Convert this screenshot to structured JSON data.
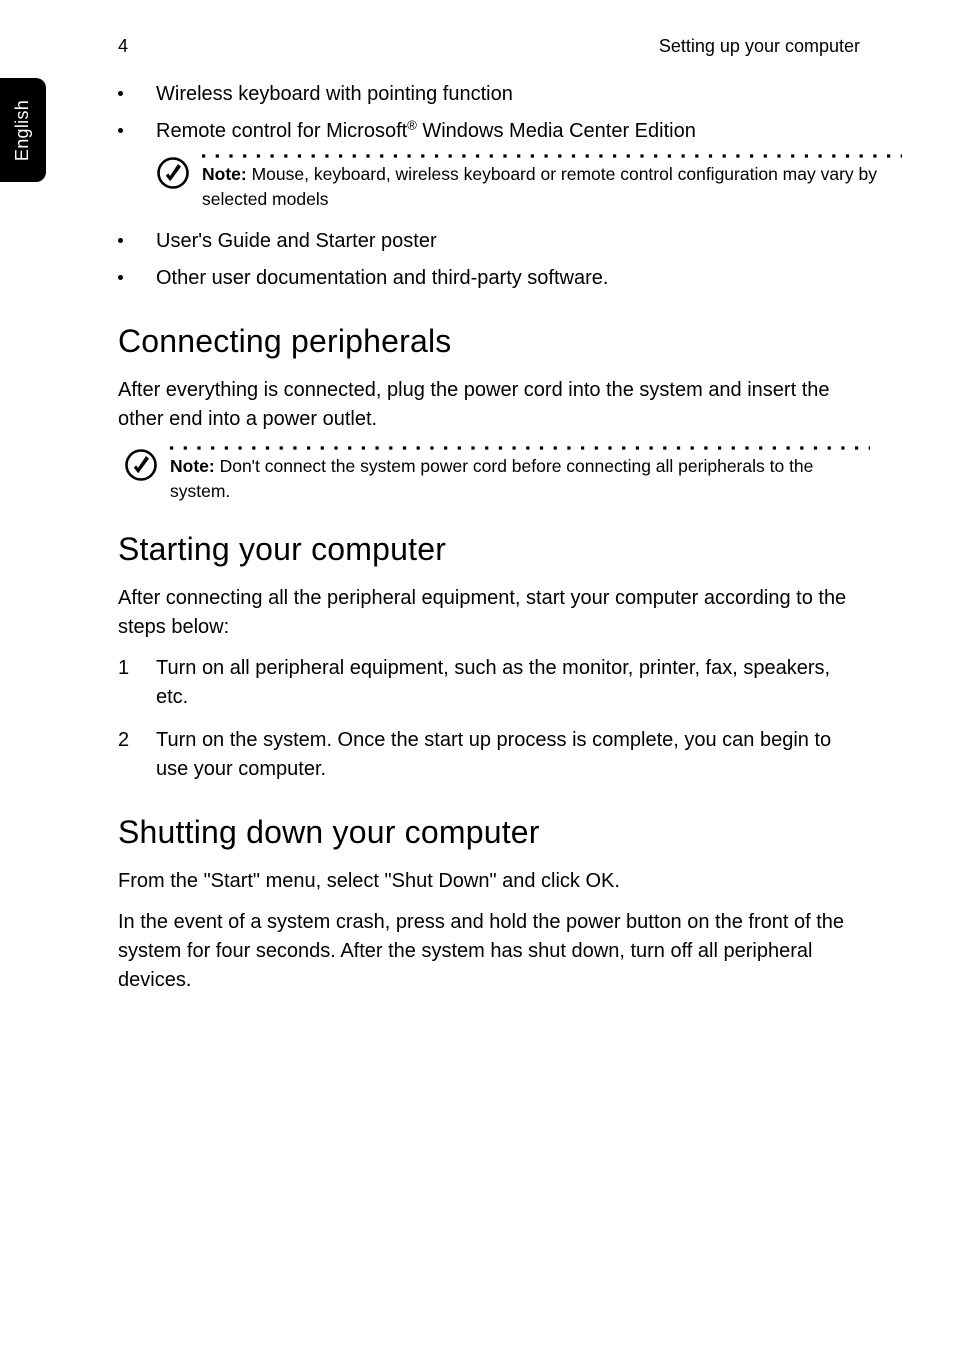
{
  "header": {
    "page_number": "4",
    "title": "Setting up your computer"
  },
  "side_tab": "English",
  "bullets_top": [
    "Wireless keyboard with pointing function",
    "Remote control for Microsoft"
  ],
  "bullets_top_suffix": " Windows Media Center Edition",
  "note1": {
    "label": "Note:",
    "text": " Mouse, keyboard, wireless keyboard or remote control configuration may vary by selected models"
  },
  "bullets_mid": [
    "User's Guide and Starter poster",
    "Other user documentation and third-party software."
  ],
  "section1": {
    "title": "Connecting peripherals",
    "body": "After everything is connected, plug the power cord into the system and insert the other end into a power outlet."
  },
  "note2": {
    "label": "Note:",
    "text": " Don't connect the system power cord before connecting all peripherals to the system."
  },
  "section2": {
    "title": "Starting your computer",
    "body": "After connecting all the peripheral equipment, start your computer according to the steps below:",
    "steps": [
      "Turn on all peripheral equipment, such as the monitor, printer, fax, speakers, etc.",
      "Turn on the system. Once the start up process is complete, you can begin to use your computer."
    ]
  },
  "section3": {
    "title": "Shutting down your computer",
    "body1": "From the \"Start\" menu, select \"Shut Down\" and click OK.",
    "body2": "In the event of a system crash, press and hold the power button on the front of the system for four seconds. After the system has shut down, turn off all peripheral devices."
  }
}
